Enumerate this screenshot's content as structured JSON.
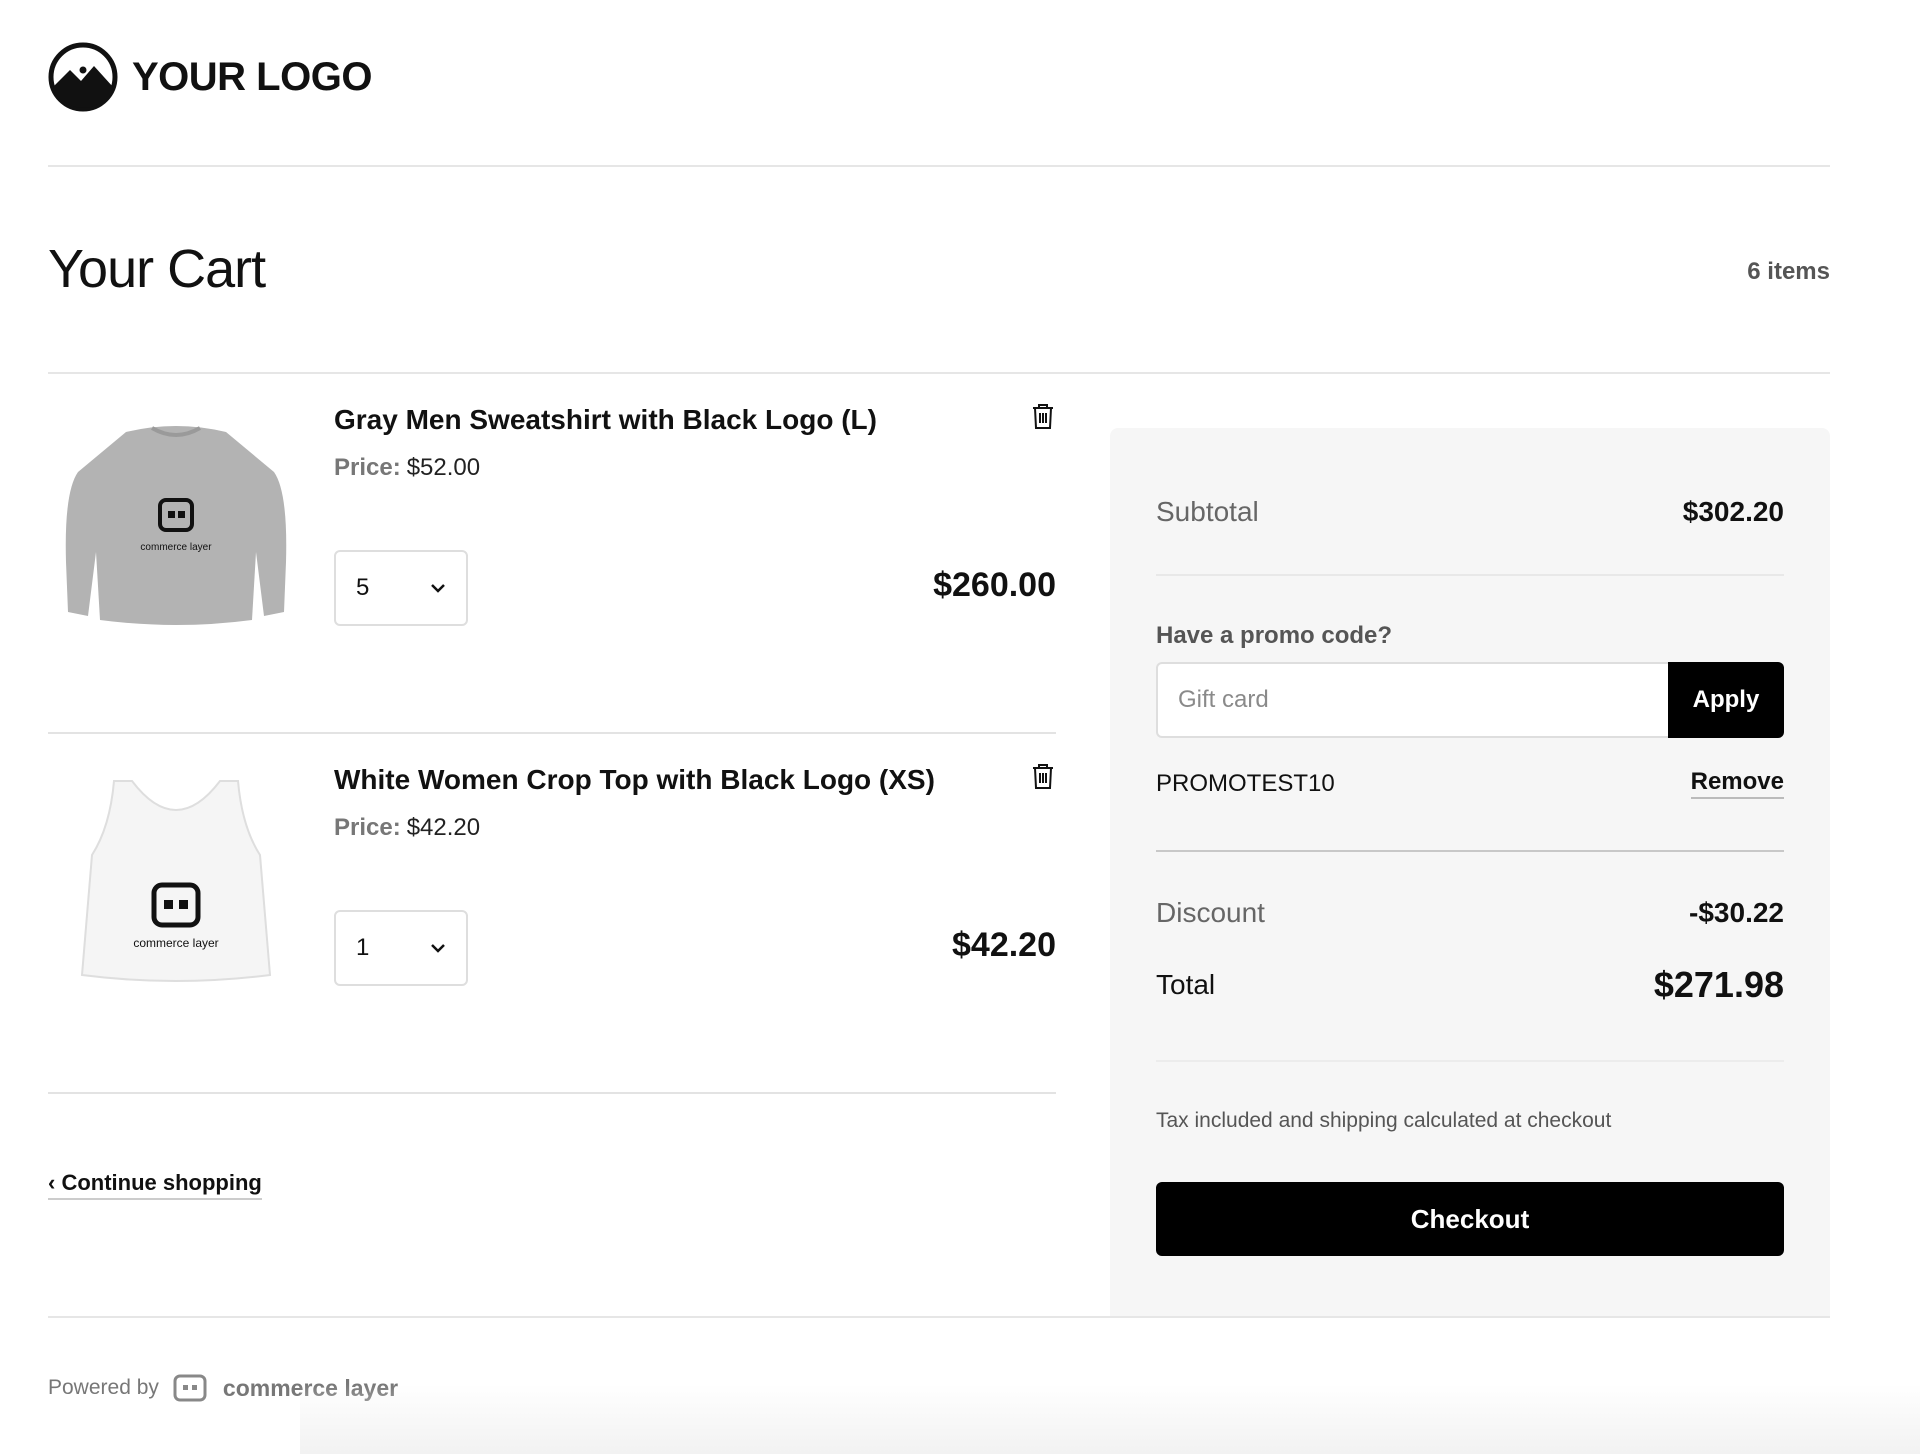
{
  "header": {
    "logo_text": "YOUR LOGO"
  },
  "cart": {
    "title": "Your Cart",
    "items_count": "6 items",
    "items": [
      {
        "name": "Gray Men Sweatshirt with Black Logo (L)",
        "price_label": "Price:",
        "price": "$52.00",
        "quantity": "5",
        "line_total": "$260.00",
        "image_brand_text": "commerce layer",
        "image_color": "#b3b3b3"
      },
      {
        "name": "White Women Crop Top with Black Logo (XS)",
        "price_label": "Price:",
        "price": "$42.20",
        "quantity": "1",
        "line_total": "$42.20",
        "image_brand_text": "commerce layer",
        "image_color": "#f5f5f5"
      }
    ],
    "continue_label": "Continue shopping"
  },
  "summary": {
    "subtotal_label": "Subtotal",
    "subtotal_value": "$302.20",
    "promo_label": "Have a promo code?",
    "promo_placeholder": "Gift card",
    "apply_label": "Apply",
    "applied_code": "PROMOTEST10",
    "remove_label": "Remove",
    "discount_label": "Discount",
    "discount_value": "-$30.22",
    "total_label": "Total",
    "total_value": "$271.98",
    "tax_note": "Tax included and shipping calculated at checkout",
    "checkout_label": "Checkout"
  },
  "footer": {
    "powered_by": "Powered by",
    "brand": "commerce layer"
  },
  "colors": {
    "accent": "#000000",
    "summary_bg": "#f6f6f6",
    "divider": "#e3e3e3",
    "muted_text": "#777777"
  }
}
